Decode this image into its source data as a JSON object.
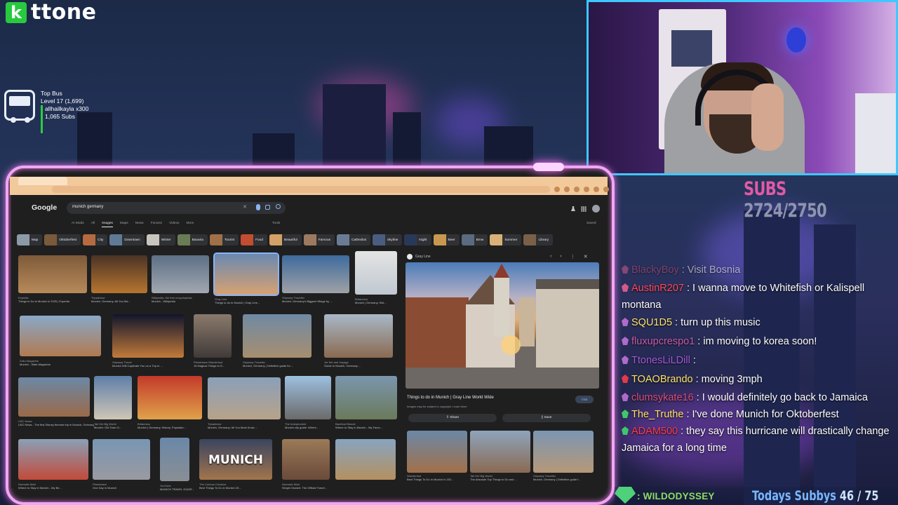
{
  "logo": {
    "text": "ttone"
  },
  "top_bus": {
    "title": "Top Bus",
    "level": "Level 17 (1,699)",
    "user": "allhailkayla x300",
    "subs": "1,065 Subs"
  },
  "subs_goal": {
    "label": "SUBS",
    "value": "2724/2750"
  },
  "browser": {
    "logo": "Google",
    "query": "munich germany",
    "tabs": [
      "AI Mode",
      "All",
      "Images",
      "Maps",
      "News",
      "Forums",
      "Videos",
      "More"
    ],
    "active_tab": "Images",
    "tools": "Tools",
    "saved": "Saved",
    "chips": [
      "Map",
      "Oktoberfest",
      "City",
      "Downtown",
      "Winter",
      "Bavaria",
      "Tourist",
      "Food",
      "Beautiful",
      "Famous",
      "Cathedral",
      "Skyline",
      "Night",
      "Beer",
      "Bmw",
      "Summer",
      "Library"
    ],
    "results": [
      {
        "src": "Expedia",
        "title": "Things to Do in Munich in 2025 | Expedia"
      },
      {
        "src": "Tripadvisor",
        "title": "Munich, Germany: All You Ma..."
      },
      {
        "src": "Wikipedia, the free encyclopedia",
        "title": "Munich - Wikipedia"
      },
      {
        "src": "Gray Line",
        "title": "Things to do in Munich | Gray Line..."
      },
      {
        "src": "Odyssey Traveller",
        "title": "Munich: Germany's Biggest Village by ..."
      },
      {
        "src": "Britannica",
        "title": "Munich | Germany, Hist..."
      },
      {
        "src": "Zolio Magazine",
        "title": "Munich - Slate Magazine"
      },
      {
        "src": "Odyssey Travel",
        "title": "Munich Will Captivate You on a Trip to ..."
      },
      {
        "src": "Planetware Wanderlust",
        "title": "16 Magical Things to D..."
      },
      {
        "src": "Odyssey Traveller",
        "title": "Munich, Germany | Definitive guide for ..."
      },
      {
        "src": "Jet Set and Voyage",
        "title": "Guide to Munich, Germany ..."
      },
      {
        "src": "USC News",
        "title": "USC News - The first Disney themed trip in Munich, Germany"
      },
      {
        "src": "Tall Girl Big World",
        "title": "Munich: Old Town G..."
      },
      {
        "src": "Britannica",
        "title": "Munich | Germany, History, Populatio..."
      },
      {
        "src": "Tripadvisor",
        "title": "Munich, Germany: All You Must Know ..."
      },
      {
        "src": "The Independent",
        "title": "Munich city guide: Where..."
      },
      {
        "src": "Barefoot Blonde",
        "title": "Where to Stay in Munich - My Favor..."
      },
      {
        "src": "Nomadic Matt",
        "title": "Where to Stay in Munich - My Be..."
      },
      {
        "src": "Planetware",
        "title": "One Day in Munich"
      },
      {
        "src": "YouTube",
        "title": "MUNICH TRAVEL GUIDE - 9 Thin..."
      },
      {
        "src": "The Curious Creature",
        "title": "Best Things To Do in Munich 20..."
      },
      {
        "src": "Nomadic Matt",
        "title": "Simple Munich: The Official Travel..."
      }
    ],
    "munich_overlay": "MUNICH",
    "panel": {
      "source": "Gray Line",
      "title": "Things to do in Munich | Gray Line World Wide",
      "subtitle": "Images may be subject to copyright. Learn More",
      "visit": "Visit",
      "share": "Share",
      "save": "Save",
      "related": [
        {
          "src": "Wanderlust",
          "title": "Best Things To Do In Munich In 202..."
        },
        {
          "src": "Tall Girl Big World",
          "title": "The Absolute Top Things to Do and ..."
        },
        {
          "src": "Odyssey Traveller",
          "title": "Munich, Germany | Definitive guide f..."
        }
      ]
    }
  },
  "chat": [
    {
      "name": "BlackyBoy",
      "text": " : Visit Bosnia",
      "color": "#c0507a"
    },
    {
      "name": "AustinR207",
      "text": " : I wanna move to Whitefish or Kalispell montana",
      "color": "#ff4a5a"
    },
    {
      "name": "SQU1D5",
      "text": " : turn up this music",
      "color": "#ffe46a"
    },
    {
      "name": "fluxupcrespo1",
      "text": " : im moving to korea soon!",
      "color": "#c85aaa"
    },
    {
      "name": "TtonesLiLDill",
      "text": " : ",
      "color": "#a45ad8"
    },
    {
      "name": "TOAOBrando",
      "text": " : moving 3mph",
      "color": "#ffe46a"
    },
    {
      "name": "clumsykate16",
      "text": " : I would definitely go back to Jamaica",
      "color": "#d8507a"
    },
    {
      "name": "The_Truthe",
      "text": " : I've done Munich for Oktoberfest",
      "color": "#ffe46a"
    },
    {
      "name": "ADAM500",
      "text": " : they say this hurricane will drastically change Jamaica for a long time",
      "color": "#ff3b4b"
    }
  ],
  "bottom": {
    "last_sub": ": WILDODYSSEY",
    "today_label": "Todays Subbys",
    "today_count": "46 / 75"
  },
  "colors": {
    "frame_glow": "#f0a6f4",
    "cam_border": "#3ec8ff",
    "subs_label": "#e05aa6",
    "last_sub": "#8bdc62",
    "todays": "#79b7ff"
  }
}
